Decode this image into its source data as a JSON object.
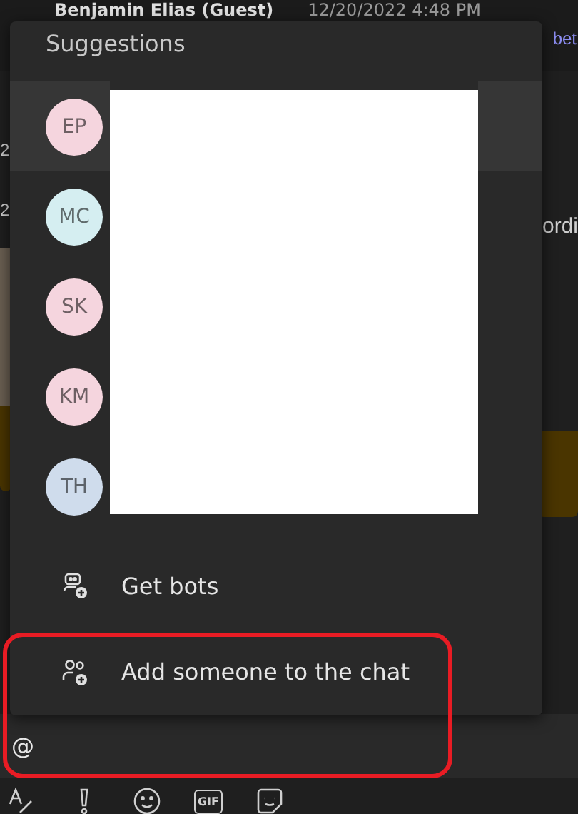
{
  "message_header": {
    "sender": "Benjamin Elias (Guest)",
    "time": "12/20/2022 4:48 PM"
  },
  "background_fragments": {
    "link": "bet",
    "left_texts": [
      "2",
      "2"
    ],
    "right_text": "ordi"
  },
  "suggestions_popup": {
    "title": "Suggestions",
    "people": [
      {
        "initials": "EP",
        "color": "#f5d5de",
        "selected": true
      },
      {
        "initials": "MC",
        "color": "#d5eef1",
        "selected": false
      },
      {
        "initials": "SK",
        "color": "#f5d5de",
        "selected": false
      },
      {
        "initials": "KM",
        "color": "#f5d5de",
        "selected": false
      },
      {
        "initials": "TH",
        "color": "#cfdcec",
        "selected": false
      }
    ],
    "actions": [
      {
        "kind": "bots",
        "label": "Get bots"
      },
      {
        "kind": "add-person",
        "label": "Add someone to the chat"
      }
    ]
  },
  "composer": {
    "value": "@"
  },
  "toolbar": [
    {
      "kind": "format"
    },
    {
      "kind": "important"
    },
    {
      "kind": "emoji"
    },
    {
      "kind": "gif",
      "label": "GIF"
    },
    {
      "kind": "sticker"
    }
  ]
}
